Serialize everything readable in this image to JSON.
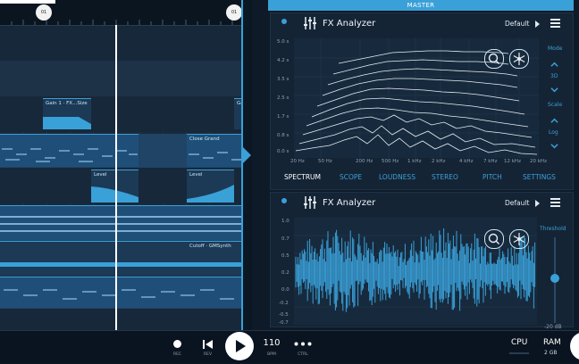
{
  "arranger": {
    "locators": [
      "01",
      "01"
    ],
    "clips": {
      "gain": "Gain 1 · FX...Size",
      "close_grand": "Close Grand",
      "level_1": "Level",
      "level_2": "Level",
      "cutoff": "Cutoff · GMSynth",
      "edge": "Ga"
    }
  },
  "panel": {
    "master_label": "MASTER",
    "analyzer_top": {
      "title": "FX Analyzer",
      "preset": "Default",
      "y_ticks": [
        "5.0 s",
        "4.2 s",
        "3.5 s",
        "2.5 s",
        "1.7 s",
        "0.8 s",
        "0.0 s"
      ],
      "x_ticks": [
        "20 Hz",
        "50 Hz",
        "200 Hz",
        "500 Hz",
        "1 kHz",
        "2 kHz",
        "4 kHz",
        "7 kHz",
        "12 kHz",
        "20 kHz"
      ],
      "mode_label": "Mode",
      "mode_value": "3D",
      "scale_label": "Scale",
      "scale_value": "Log",
      "tabs": [
        "SPECTRUM",
        "SCOPE",
        "LOUDNESS",
        "STEREO",
        "PITCH",
        "SETTINGS"
      ]
    },
    "analyzer_bottom": {
      "title": "FX Analyzer",
      "preset": "Default",
      "y_ticks": [
        "1.0",
        "0.7",
        "0.5",
        "0.2",
        "0.0",
        "-0.2",
        "-0.5",
        "-0.7"
      ],
      "threshold_label": "Threshold",
      "threshold_value": "-20 dB"
    }
  },
  "transport": {
    "rec_label": "REC",
    "rev_label": "REV",
    "tempo": "110",
    "bpm_label": "BPM",
    "ctrl_label": "CTRL",
    "cpu_label": "CPU",
    "ram_label": "RAM",
    "ram_value": "2 GB"
  },
  "colors": {
    "accent": "#3aa0d8",
    "background": "#0c1724",
    "clip": "#1f6ea3"
  },
  "icons": [
    "eq-sliders-icon",
    "menu-icon",
    "search-icon",
    "freeze-icon",
    "chevron-up-icon",
    "chevron-down-icon",
    "record-icon",
    "rewind-icon",
    "play-icon",
    "more-icon"
  ]
}
